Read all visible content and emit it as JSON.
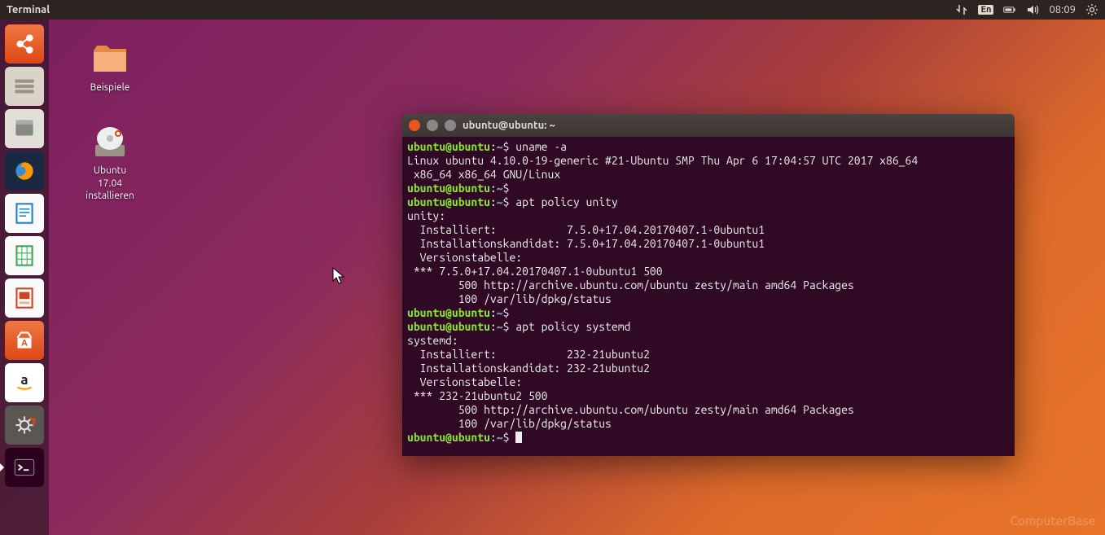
{
  "topbar": {
    "title": "Terminal",
    "lang": "En",
    "time": "08:09"
  },
  "launcher": {
    "items": [
      {
        "name": "dash",
        "color": "#dd4814"
      },
      {
        "name": "files",
        "color": "#bfb8a8"
      },
      {
        "name": "disk-utility",
        "color": "#9e9e9e"
      },
      {
        "name": "firefox",
        "color": "#ff9500"
      },
      {
        "name": "writer",
        "color": "#2284c6"
      },
      {
        "name": "calc",
        "color": "#3fa757"
      },
      {
        "name": "impress",
        "color": "#d04423"
      },
      {
        "name": "software",
        "color": "#dd4814"
      },
      {
        "name": "amazon",
        "color": "#fff"
      },
      {
        "name": "settings",
        "color": "#6c6c6c"
      },
      {
        "name": "terminal",
        "color": "#2c001e"
      }
    ]
  },
  "desktop": {
    "icons": [
      {
        "name": "examples",
        "label": "Beispiele"
      },
      {
        "name": "install",
        "label": "Ubuntu\n17.04\ninstallieren"
      }
    ]
  },
  "terminal": {
    "title": "ubuntu@ubuntu: ~",
    "prompt_user": "ubuntu@ubuntu",
    "prompt_path": "~",
    "prompt_sep": ":",
    "prompt_end": "$",
    "lines": [
      {
        "type": "cmd",
        "text": "uname -a"
      },
      {
        "type": "out",
        "text": "Linux ubuntu 4.10.0-19-generic #21-Ubuntu SMP Thu Apr 6 17:04:57 UTC 2017 x86_64\n x86_64 x86_64 GNU/Linux"
      },
      {
        "type": "cmd",
        "text": ""
      },
      {
        "type": "cmd",
        "text": "apt policy unity"
      },
      {
        "type": "out",
        "text": "unity:\n  Installiert:           7.5.0+17.04.20170407.1-0ubuntu1\n  Installationskandidat: 7.5.0+17.04.20170407.1-0ubuntu1\n  Versionstabelle:\n *** 7.5.0+17.04.20170407.1-0ubuntu1 500\n        500 http://archive.ubuntu.com/ubuntu zesty/main amd64 Packages\n        100 /var/lib/dpkg/status"
      },
      {
        "type": "cmd",
        "text": ""
      },
      {
        "type": "cmd",
        "text": "apt policy systemd"
      },
      {
        "type": "out",
        "text": "systemd:\n  Installiert:           232-21ubuntu2\n  Installationskandidat: 232-21ubuntu2\n  Versionstabelle:\n *** 232-21ubuntu2 500\n        500 http://archive.ubuntu.com/ubuntu zesty/main amd64 Packages\n        100 /var/lib/dpkg/status"
      },
      {
        "type": "prompt"
      }
    ]
  },
  "watermark": "ComputerBase"
}
